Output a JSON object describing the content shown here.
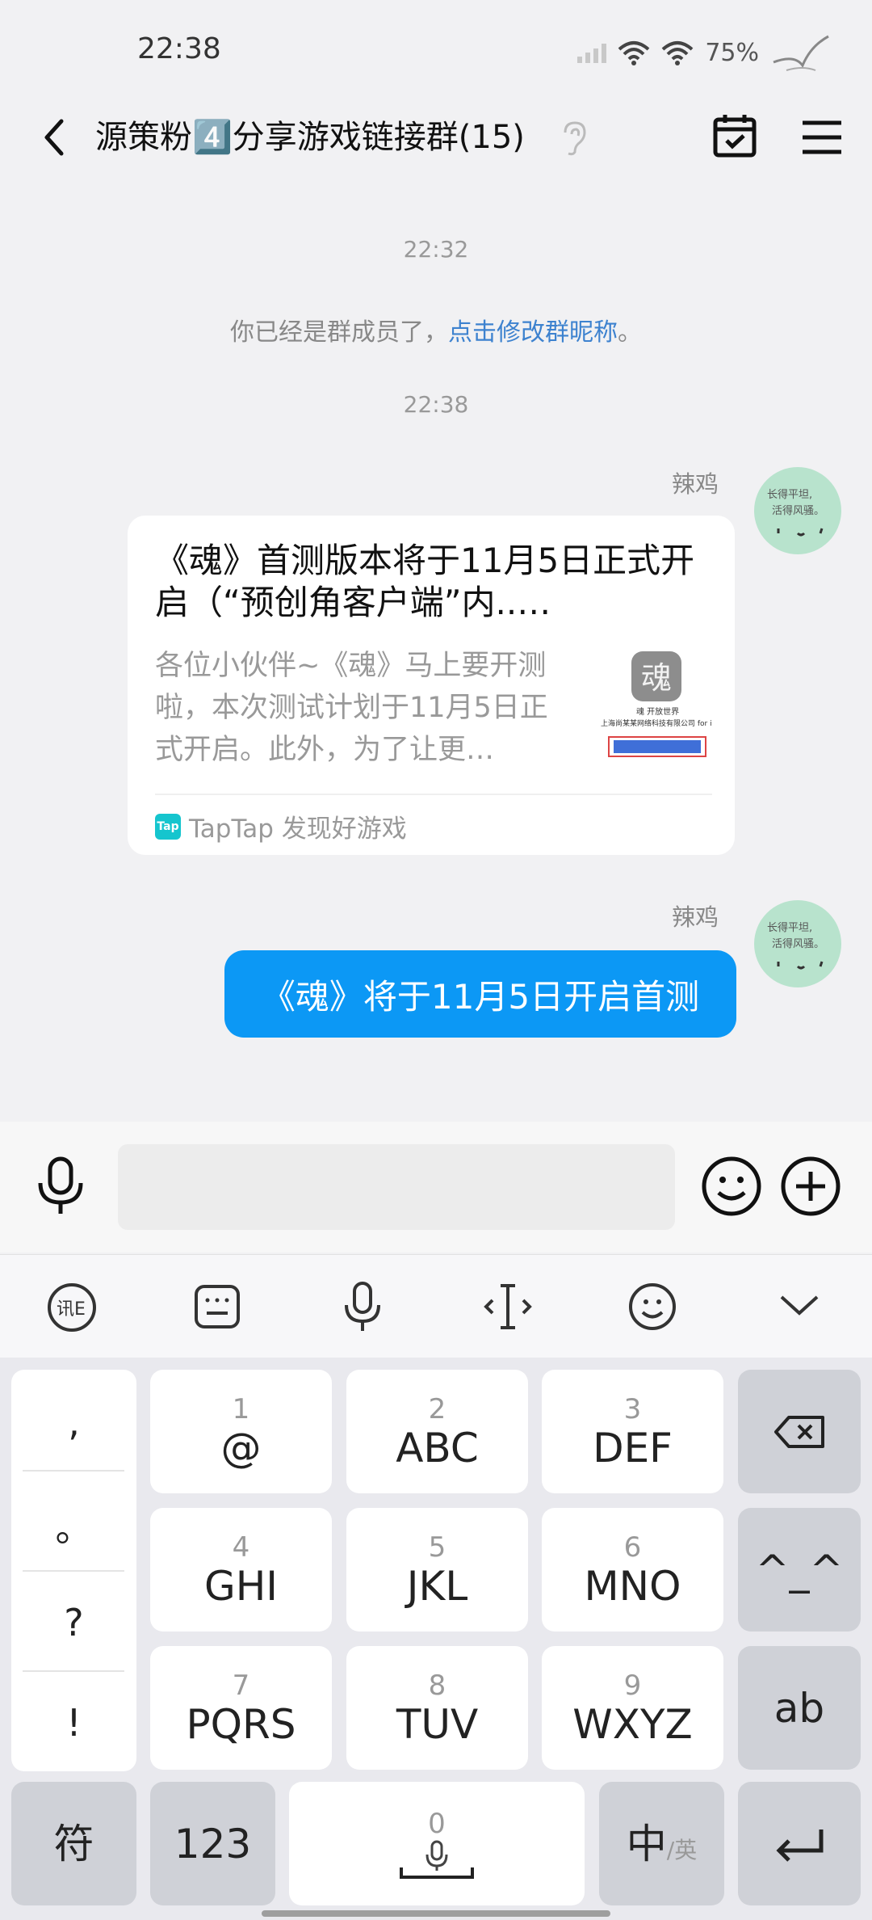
{
  "status_bar": {
    "time": "22:38",
    "battery": "75%"
  },
  "header": {
    "title": "源策粉4️⃣分享游戏链接群(15)"
  },
  "chat": {
    "timestamp_1": "22:32",
    "system_message_prefix": "你已经是群成员了，",
    "system_message_link": "点击修改群昵称",
    "system_message_suffix": "。",
    "timestamp_2": "22:38",
    "messages": [
      {
        "sender": "辣鸡",
        "type": "link_card",
        "title": "《魂》首测版本将于11月5日正式开启（“预创角客户端”内..…",
        "description": "各位小伙伴~《魂》马上要开测啦，本次测试计划于11月5日正式开启。此外，为了让更…",
        "source": "TapTap 发现好游戏",
        "source_logo_text": "Tap",
        "thumb_text_1": "魂 开放世界",
        "thumb_text_2": "上海尚某某网络科技有限公司 for ii"
      },
      {
        "sender": "辣鸡",
        "type": "text",
        "text": "《魂》将于11月5日开启首测"
      }
    ],
    "avatar_text_1": "长得平坦,",
    "avatar_text_2": "活得风骚。"
  },
  "input": {
    "placeholder": ""
  },
  "keyboard": {
    "punctuation": [
      ",",
      "。",
      "?",
      "!"
    ],
    "keys": [
      {
        "num": "1",
        "label": "@"
      },
      {
        "num": "2",
        "label": "ABC"
      },
      {
        "num": "3",
        "label": "DEF"
      },
      {
        "num": "4",
        "label": "GHI"
      },
      {
        "num": "5",
        "label": "JKL"
      },
      {
        "num": "6",
        "label": "MNO"
      },
      {
        "num": "7",
        "label": "PQRS"
      },
      {
        "num": "8",
        "label": "TUV"
      },
      {
        "num": "9",
        "label": "WXYZ"
      }
    ],
    "emoticon_key": "^_^",
    "ab_key": "ab",
    "symbols_key": "符",
    "numbers_key": "123",
    "space_num": "0",
    "lang_key_main": "中",
    "lang_key_sub": "/英"
  },
  "colors": {
    "accent_blue": "#0c98f5",
    "link_blue": "#3d82cf",
    "background": "#f1f1f3"
  }
}
